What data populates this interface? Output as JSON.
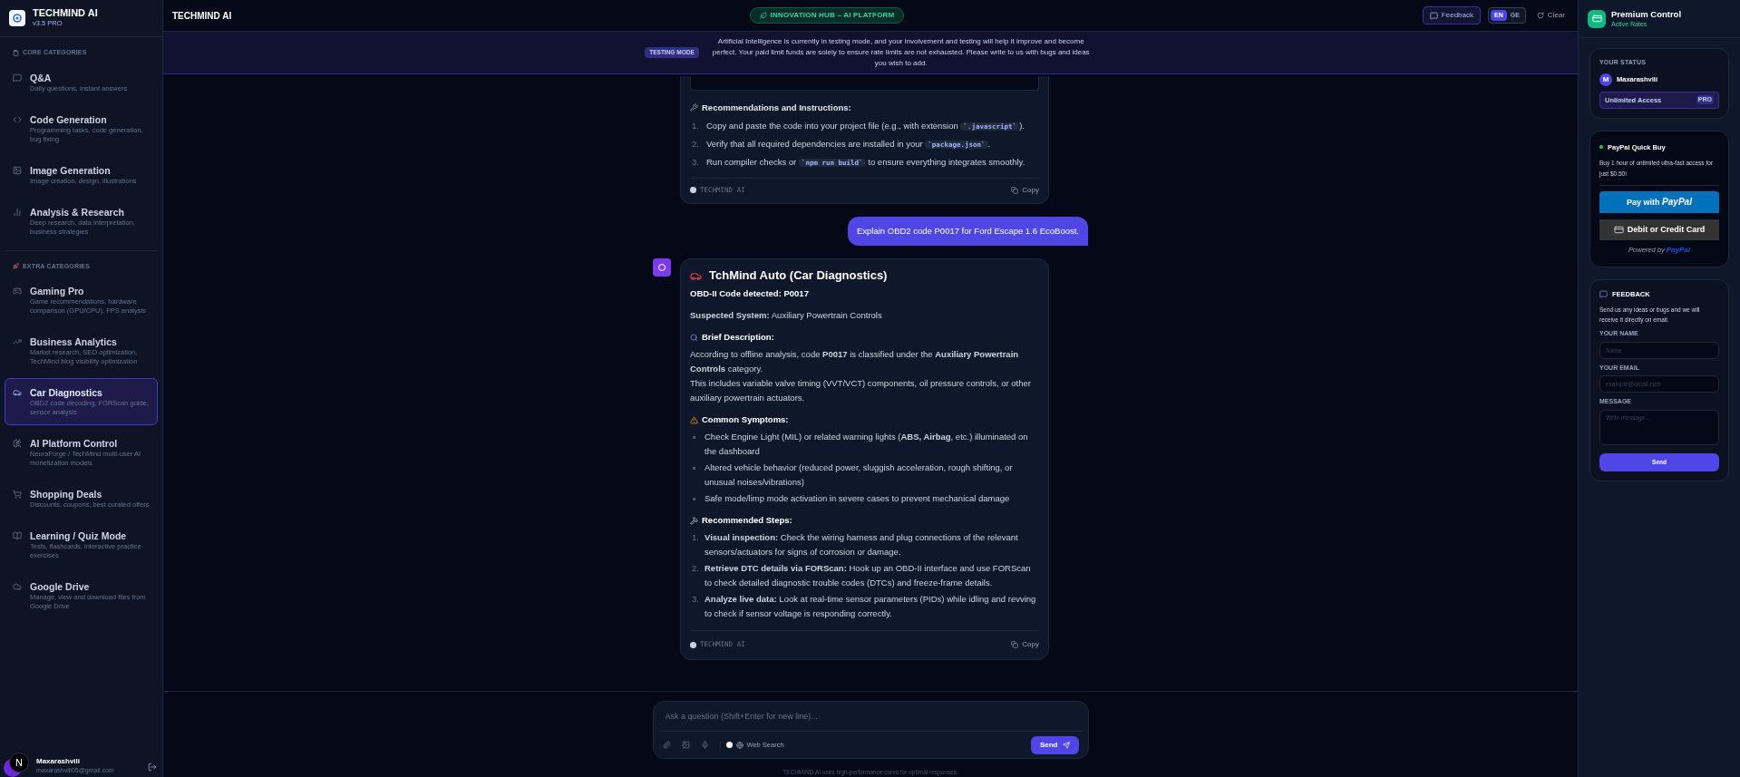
{
  "sidebar": {
    "brand": {
      "name": "TECHMIND AI",
      "version": "v3.5 PRO"
    },
    "sections": [
      {
        "title": "CORE CATEGORIES",
        "items": [
          {
            "title": "Q&A",
            "description": "Daily questions, instant answers",
            "selected": false
          },
          {
            "title": "Code Generation",
            "description": "Programming tasks, code generation, bug fixing",
            "selected": false
          },
          {
            "title": "Image Generation",
            "description": "Image creation, design, illustrations",
            "selected": false
          },
          {
            "title": "Analysis & Research",
            "description": "Deep research, data interpretation, business strategies",
            "selected": false
          }
        ]
      },
      {
        "title": "EXTRA CATEGORIES",
        "items": [
          {
            "title": "Gaming Pro",
            "description": "Game recommendations, hardware comparison (GPU/CPU), FPS analysis",
            "selected": false
          },
          {
            "title": "Business Analytics",
            "description": "Market research, SEO optimization, TechMind blog visibility optimization",
            "selected": false
          },
          {
            "title": "Car Diagnostics",
            "description": "OBD2 code decoding, FORScan guide, sensor analysis",
            "selected": true
          },
          {
            "title": "AI Platform Control",
            "description": "NeuraForge / TechMind multi-user AI monetization models",
            "selected": false
          },
          {
            "title": "Shopping Deals",
            "description": "Discounts, coupons, best curated offers",
            "selected": false
          },
          {
            "title": "Learning / Quiz Mode",
            "description": "Tests, flashcards, interactive practice exercises",
            "selected": false
          },
          {
            "title": "Google Drive",
            "description": "Manage, view and download files from Google Drive",
            "selected": false
          }
        ]
      }
    ],
    "user": {
      "name": "Maxarashvili",
      "email": "maxarashvili05@gmail.com",
      "dev_badge": "N"
    }
  },
  "header": {
    "title": "TECHMIND AI",
    "hub_badge": "INNOVATION HUB – AI PLATFORM",
    "feedback": "Feedback",
    "languages": [
      {
        "label": "EN",
        "selected": true
      },
      {
        "label": "GE",
        "selected": false
      }
    ],
    "clear": "Clear"
  },
  "banner": {
    "tag": "TESTING MODE",
    "text": "Artificial Intelligence is currently in testing mode, and your involvement and testing will help it improve and become perfect. Your paid limit funds are solely to ensure rate limits are not exhausted. Please write to us with bugs and ideas you wish to add."
  },
  "messages": [
    {
      "kind": "assistant_partial",
      "heading": "Recommendations and Instructions:",
      "steps": [
        {
          "number": "1.",
          "parts": [
            {
              "kind": "text",
              "text": "Copy and paste the code into your project file (e.g., with extension "
            },
            {
              "kind": "code",
              "text": "`.javascript`"
            },
            {
              "kind": "text",
              "text": ")."
            }
          ]
        },
        {
          "number": "2.",
          "parts": [
            {
              "kind": "text",
              "text": "Verify that all required dependencies are installed in your "
            },
            {
              "kind": "code",
              "text": "`package.json`"
            },
            {
              "kind": "text",
              "text": "."
            }
          ]
        },
        {
          "number": "3.",
          "parts": [
            {
              "kind": "text",
              "text": "Run compiler checks or "
            },
            {
              "kind": "code",
              "text": "`npm run build`"
            },
            {
              "kind": "text",
              "text": " to ensure everything integrates smoothly."
            }
          ]
        }
      ],
      "footer_brand": "TECHMIND AI",
      "copy": "Copy"
    },
    {
      "kind": "user",
      "text": "Explain OBD2 code P0017 for Ford Escape 1.6 EcoBoost."
    },
    {
      "kind": "assistant",
      "title": "TchMind Auto (Car Diagnostics)",
      "code_line": "OBD-II Code detected: P0017",
      "system_line": "**Suspected System:** Auxiliary Powertrain Controls",
      "sections": [
        {
          "heading": "Brief Description:",
          "kind": "paragraphs",
          "items": [
            {
              "text": "According to offline analysis, code **P0017** is classified under the **Auxiliary Powertrain Controls** category."
            },
            {
              "text": "This includes variable valve timing (VVT/VCT) components, oil pressure controls, or other auxiliary powertrain actuators."
            }
          ]
        },
        {
          "heading": "Common Symptoms:",
          "kind": "bullets",
          "items": [
            {
              "text": "Check Engine Light (MIL) or related warning lights (**ABS, Airbag**, etc.) illuminated on the dashboard"
            },
            {
              "text": "Altered vehicle behavior (reduced power, sluggish acceleration, rough shifting, or unusual noises/vibrations)"
            },
            {
              "text": "Safe mode/limp mode activation in severe cases to prevent mechanical damage"
            }
          ]
        },
        {
          "heading": "Recommended Steps:",
          "kind": "steps",
          "items": [
            {
              "number": "1.",
              "text": "**Visual inspection:** Check the wiring harness and plug connections of the relevant sensors/actuators for signs of corrosion or damage."
            },
            {
              "number": "2.",
              "text": "**Retrieve DTC details via FORScan:** Hook up an OBD-II interface and use FORScan to check detailed diagnostic trouble codes (DTCs) and freeze-frame details."
            },
            {
              "number": "3.",
              "text": "**Analyze live data:** Look at real-time sensor parameters (PIDs) while idling and revving to check if sensor voltage is responding correctly."
            }
          ]
        }
      ],
      "footer_brand": "TECHMIND AI",
      "copy": "Copy"
    }
  ],
  "composer": {
    "placeholder": "Ask a question (Shift+Enter for new line)...",
    "web_search": {
      "label": "Web Search",
      "checked": false
    },
    "send": "Send",
    "note": "TECHMIND AI uses high-performance cores for optimal responses."
  },
  "right_panel": {
    "title": "Premium Control",
    "subtitle": "Active Rates",
    "status": {
      "heading": "YOUR STATUS",
      "avatar": "M",
      "name": "Maxarashvili",
      "access": "Unlimited Access",
      "badge": "PRO"
    },
    "paypal": {
      "title": "PayPal Quick Buy",
      "text": "Buy 1 hour of unlimited ultra-fast access for just $0.50!",
      "pay_prefix": "Pay with",
      "pay_brand": "PayPal",
      "card_button": "Debit or Credit Card",
      "powered_prefix": "Powered by",
      "powered_brand": "PayPal"
    },
    "feedback": {
      "heading": "FEEDBACK",
      "text": "Send us any ideas or bugs and we will receive it directly on email.",
      "fields": [
        {
          "label": "YOUR NAME",
          "placeholder": "Name",
          "kind": "input"
        },
        {
          "label": "YOUR EMAIL",
          "placeholder": "example@gmail.com",
          "kind": "input"
        },
        {
          "label": "MESSAGE",
          "placeholder": "Write message...",
          "kind": "textarea"
        }
      ],
      "send": "Send"
    }
  }
}
